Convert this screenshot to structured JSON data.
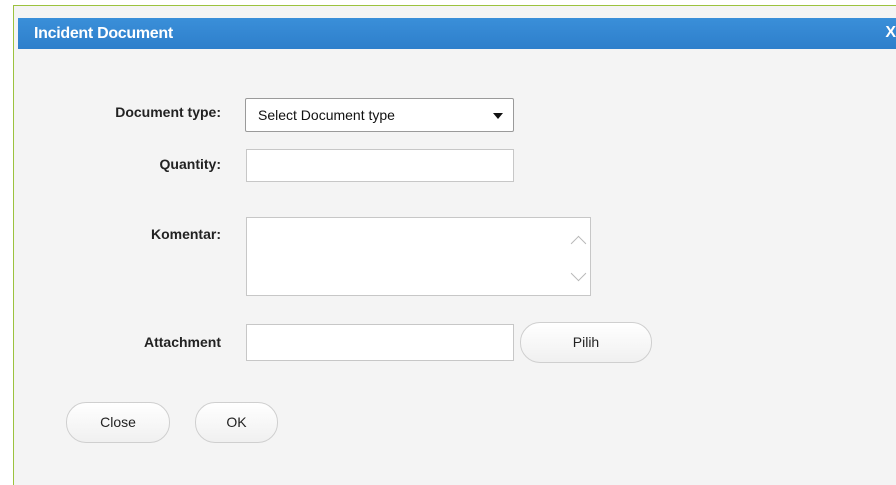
{
  "dialog": {
    "title": "Incident Document",
    "close_label": "X"
  },
  "form": {
    "document_type": {
      "label": "Document type:",
      "selected": "Select Document type"
    },
    "quantity": {
      "label": "Quantity:",
      "value": ""
    },
    "komentar": {
      "label": "Komentar:",
      "value": ""
    },
    "attachment": {
      "label": "Attachment",
      "value": "",
      "browse_label": "Pilih"
    }
  },
  "actions": {
    "close_label": "Close",
    "ok_label": "OK"
  },
  "colors": {
    "titlebar": "#2e7fcb",
    "border": "#9cc23e",
    "background": "#f4f4f4"
  }
}
